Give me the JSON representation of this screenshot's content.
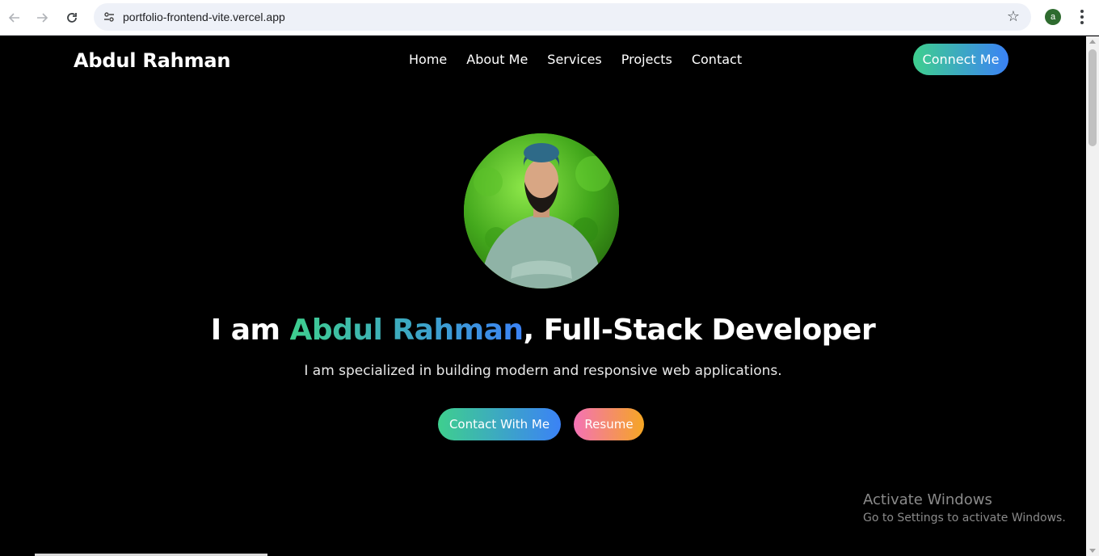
{
  "browser": {
    "url": "portfolio-frontend-vite.vercel.app",
    "profile_initial": "a"
  },
  "site": {
    "logo": "Abdul Rahman",
    "nav": [
      "Home",
      "About Me",
      "Services",
      "Projects",
      "Contact"
    ],
    "connect_label": "Connect Me"
  },
  "hero": {
    "headline_prefix": "I am ",
    "headline_name": "Abdul Rahman",
    "headline_suffix": ", Full-Stack Developer",
    "subtitle": "I am specialized in building modern and responsive web applications.",
    "contact_label": "Contact With Me",
    "resume_label": "Resume"
  },
  "watermark": {
    "title": "Activate Windows",
    "subtitle": "Go to Settings to activate Windows."
  },
  "colors": {
    "gradient_start": "#3ecf8e",
    "gradient_end": "#3b82f6",
    "resume_start": "#f472b6",
    "resume_end": "#f5a623"
  }
}
